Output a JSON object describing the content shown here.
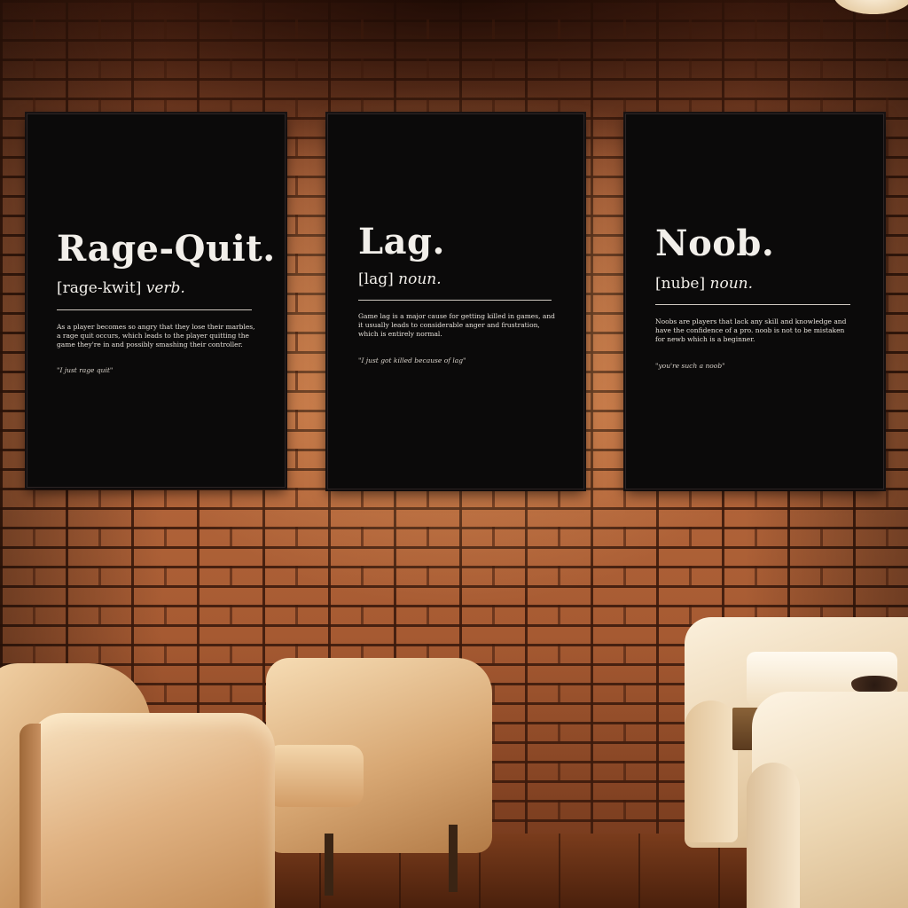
{
  "posters": [
    {
      "term": "Rage-Quit.",
      "pronunciation": "[rage-kwit]",
      "part_of_speech": "verb.",
      "definition": "As a player becomes so angry that they lose their marbles, a rage quit occurs, which leads to the player quitting the game they're in and possibly smashing their controller.",
      "example": "\"I just rage quit\""
    },
    {
      "term": "Lag.",
      "pronunciation": "[lag]",
      "part_of_speech": "noun.",
      "definition": "Game lag is a major cause for getting killed in games, and it usually leads to considerable anger and frustration, which is entirely normal.",
      "example": "\"I just got killed because of lag\""
    },
    {
      "term": "Noob.",
      "pronunciation": "[nube]",
      "part_of_speech": "noun.",
      "definition": "Noobs are players that lack any skill and knowledge and have the confidence of a pro. noob is not to be mistaken for newb which is a beginner.",
      "example": "\"you're such a noob\""
    }
  ]
}
